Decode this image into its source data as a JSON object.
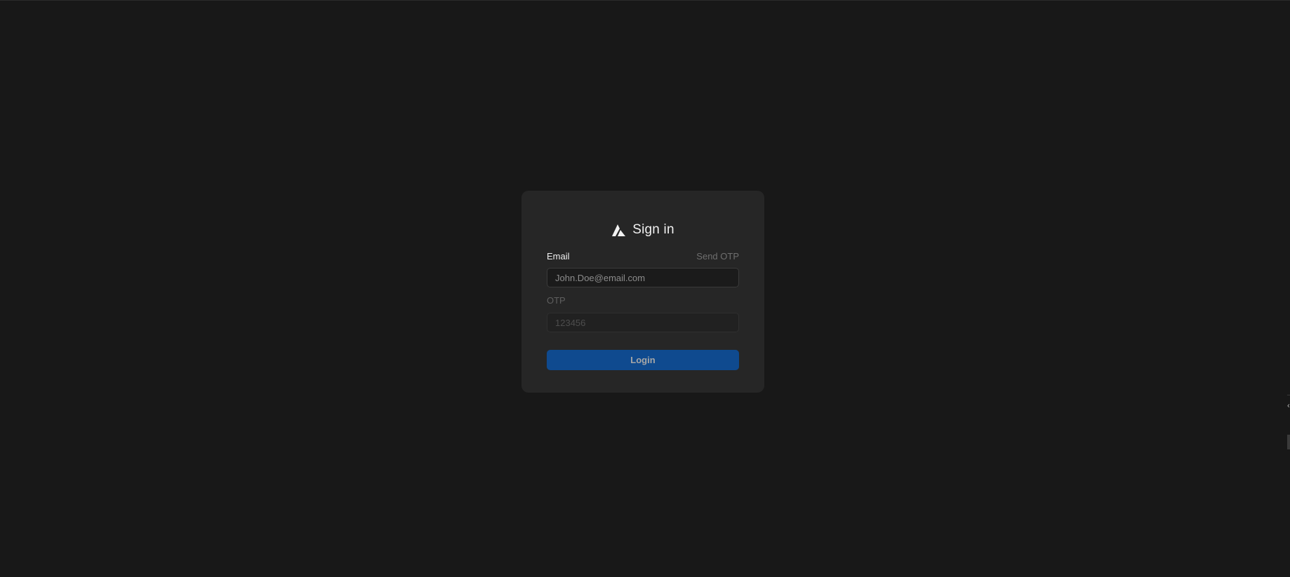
{
  "login": {
    "title": "Sign in",
    "logo_icon": "triangle-logo-icon",
    "email_label": "Email",
    "send_otp_label": "Send OTP",
    "email_placeholder": "John.Doe@email.com",
    "otp_label": "OTP",
    "otp_placeholder": "123456",
    "login_button": "Login"
  },
  "colors": {
    "background": "#181818",
    "card": "#262626",
    "accent": "#0f4a8f"
  }
}
